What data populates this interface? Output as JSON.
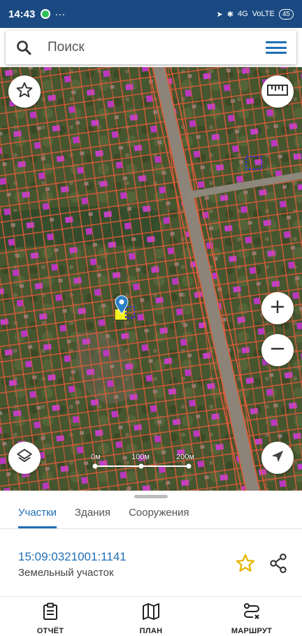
{
  "status_bar": {
    "time": "14:43",
    "dots": "···",
    "network": "4G",
    "lte": "VoLTE",
    "battery": "45"
  },
  "search": {
    "placeholder": "Поиск"
  },
  "map": {
    "scale_labels": [
      "0м",
      "100м",
      "200м"
    ],
    "colors": {
      "parcel_border": "#e25a3a",
      "building": "#c040c8",
      "selected": "#f2f020",
      "pin": "#2a7fc6"
    }
  },
  "tabs": [
    {
      "label": "Участки",
      "active": true
    },
    {
      "label": "Здания",
      "active": false
    },
    {
      "label": "Сооружения",
      "active": false
    }
  ],
  "parcel": {
    "cadastral_number": "15:09:0321001:1141",
    "type": "Земельный участок"
  },
  "bottom_nav": [
    {
      "label": "ОТЧЁТ",
      "icon": "report-icon"
    },
    {
      "label": "ПЛАН",
      "icon": "map-plan-icon"
    },
    {
      "label": "МАРШРУТ",
      "icon": "route-icon"
    }
  ],
  "accent_color": "#1f6fb5"
}
